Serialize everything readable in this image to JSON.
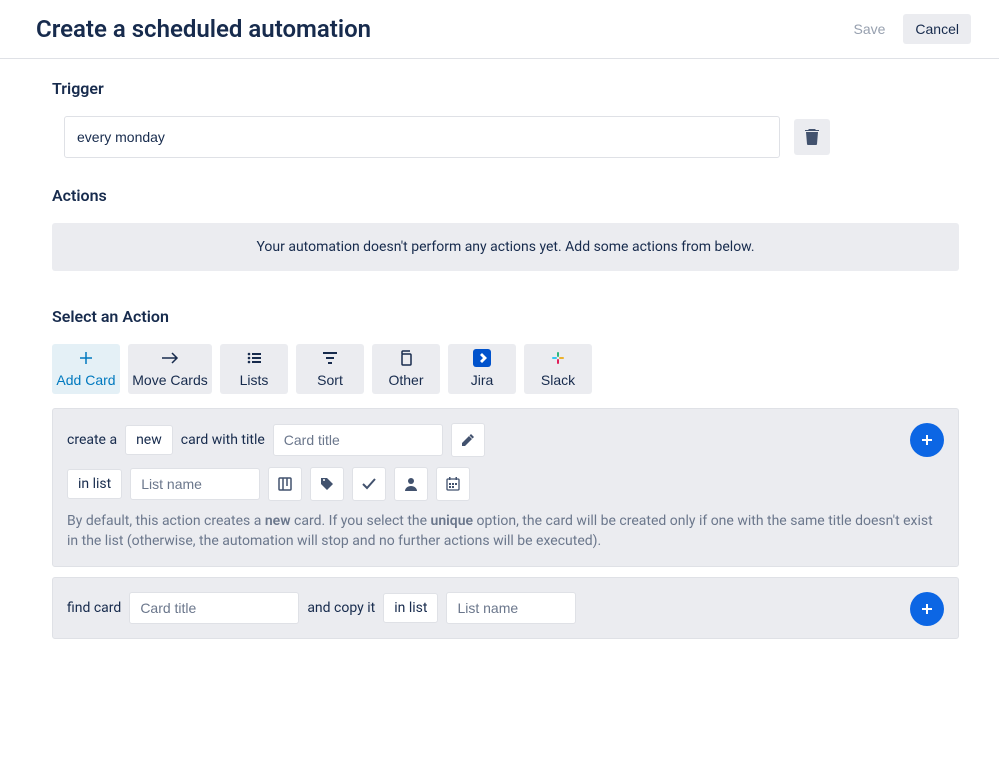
{
  "header": {
    "title": "Create a scheduled automation",
    "save": "Save",
    "cancel": "Cancel"
  },
  "trigger": {
    "title": "Trigger",
    "value": "every monday"
  },
  "actions": {
    "title": "Actions",
    "empty_text": "Your automation doesn't perform any actions yet. Add some actions from below."
  },
  "select_action": {
    "title": "Select an Action",
    "tabs": {
      "add_card": "Add Card",
      "move_cards": "Move Cards",
      "lists": "Lists",
      "sort": "Sort",
      "other": "Other",
      "jira": "Jira",
      "slack": "Slack"
    }
  },
  "panel_create": {
    "t_create_a": "create a",
    "new_pill": "new",
    "t_card_with_title": "card with title",
    "card_title_ph": "Card title",
    "t_in_list": "in list",
    "list_name_ph": "List name",
    "desc_p1": "By default, this action creates a ",
    "desc_b1": "new",
    "desc_p2": " card. If you select the ",
    "desc_b2": "unique",
    "desc_p3": " option, the card will be created only if one with the same title doesn't exist in the list (otherwise, the automation will stop and no further actions will be executed)."
  },
  "panel_find": {
    "t_find_card": "find card",
    "card_title_ph": "Card title",
    "t_and_copy": "and copy it",
    "t_in_list": "in list",
    "list_name_ph": "List name"
  },
  "icons": {
    "trash": "trash-icon",
    "plus": "plus-icon",
    "arrow_right": "arrow-right-icon",
    "list": "list-icon",
    "sort": "sort-icon",
    "copy": "copy-icon",
    "jira": "jira-icon",
    "slack": "slack-icon",
    "edit": "edit-icon",
    "board": "board-icon",
    "tag": "tag-icon",
    "check": "check-icon",
    "person": "person-icon",
    "calendar": "calendar-icon"
  }
}
